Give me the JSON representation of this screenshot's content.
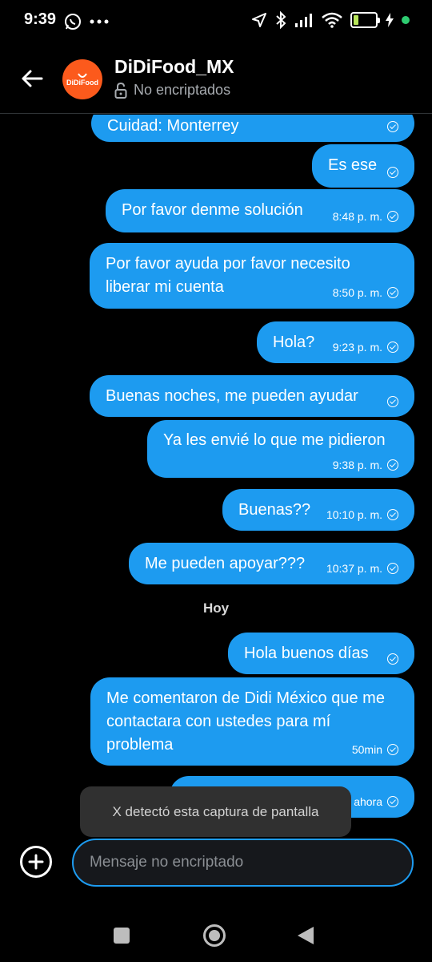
{
  "status_bar": {
    "time": "9:39",
    "battery": "22",
    "battery_level": 0.22,
    "icons_left": [
      "whatsapp-icon",
      "more-dots-icon"
    ],
    "icons_right": [
      "location-arrow-icon",
      "bluetooth-icon",
      "signal-icon",
      "wifi-icon",
      "battery-icon",
      "charging-icon"
    ],
    "dot_color": "#2ecc71"
  },
  "header": {
    "contact_name": "DiDiFood_MX",
    "encryption_status": "No encriptados",
    "avatar_text": "DiDiFood",
    "avatar_color": "#fc5a1c"
  },
  "messages": [
    {
      "text": "Cuidad: Monterrey",
      "time": ""
    },
    {
      "text": "Es ese",
      "time": ""
    },
    {
      "text": "Por favor denme solución",
      "time": "8:48 p. m."
    },
    {
      "text": "Por favor ayuda por favor necesito liberar mi cuenta",
      "time": "8:50 p. m."
    },
    {
      "text": "Hola?",
      "time": "9:23 p. m."
    },
    {
      "text": "Buenas noches, me pueden ayudar",
      "time": ""
    },
    {
      "text": "Ya les envié lo que me pidieron",
      "time": "9:38 p. m."
    },
    {
      "text": "Buenas??",
      "time": "10:10 p. m."
    },
    {
      "text": "Me pueden apoyar???",
      "time": "10:37 p. m."
    },
    {
      "text": "Hola buenos días",
      "time": ""
    },
    {
      "text": "Me comentaron de Didi México que me contactara con ustedes para mí problema",
      "time": "50min"
    },
    {
      "text": "",
      "time": "ahora"
    }
  ],
  "day_separator": "Hoy",
  "toast": "X detectó esta captura de pantalla",
  "composer": {
    "placeholder": "Mensaje no encriptado",
    "value": ""
  },
  "accent_color": "#1d9bf0"
}
